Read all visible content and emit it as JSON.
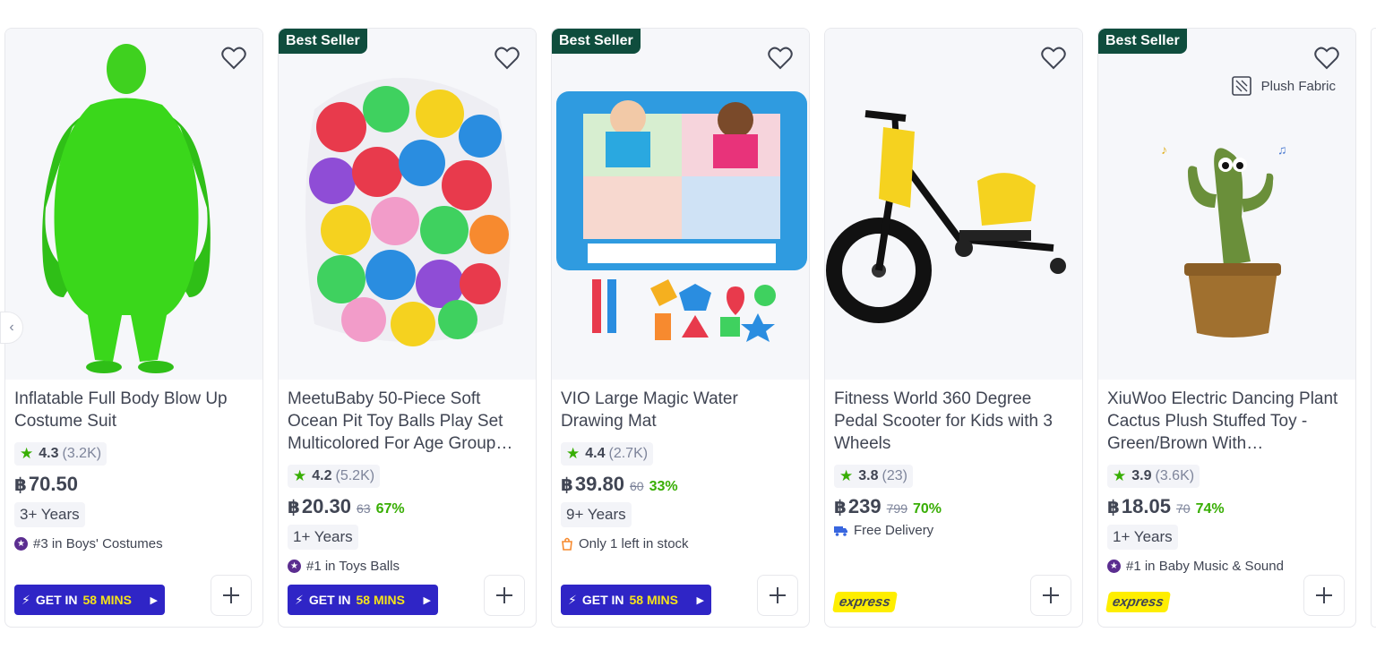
{
  "products": [
    {
      "badge": "",
      "title": "Inflatable Full Body Blow Up Costume Suit",
      "rating": "4.3",
      "rating_count": "3.2K",
      "currency": "฿",
      "price": "70.50",
      "old_price": "",
      "discount": "",
      "age": "3+ Years",
      "rank": "#3 in Boys' Costumes",
      "delivery_type": "fast",
      "fast_prefix": "GET IN",
      "fast_mins": "58 MINS"
    },
    {
      "badge": "Best Seller",
      "title": "MeetuBaby 50-Piece Soft Ocean Pit Toy Balls Play Set Multicolored For Age Group…",
      "rating": "4.2",
      "rating_count": "5.2K",
      "currency": "฿",
      "price": "20.30",
      "old_price": "63",
      "discount": "67%",
      "age": "1+ Years",
      "rank": "#1 in Toys Balls",
      "delivery_type": "fast",
      "fast_prefix": "GET IN",
      "fast_mins": "58 MINS"
    },
    {
      "badge": "Best Seller",
      "title": "VIO Large Magic Water Drawing Mat",
      "rating": "4.4",
      "rating_count": "2.7K",
      "currency": "฿",
      "price": "39.80",
      "old_price": "60",
      "discount": "33%",
      "age": "9+ Years",
      "stock": "Only 1 left in stock",
      "delivery_type": "fast",
      "fast_prefix": "GET IN",
      "fast_mins": "58 MINS"
    },
    {
      "badge": "",
      "title": "Fitness World 360 Degree Pedal Scooter for Kids with 3 Wheels",
      "rating": "3.8",
      "rating_count": "23",
      "currency": "฿",
      "price": "239",
      "old_price": "799",
      "discount": "70%",
      "free_delivery": "Free Delivery",
      "delivery_type": "express",
      "express_label": "express"
    },
    {
      "badge": "Best Seller",
      "tag": "Plush Fabric",
      "title": "XiuWoo Electric Dancing Plant Cactus Plush Stuffed Toy -Green/Brown With…",
      "rating": "3.9",
      "rating_count": "3.6K",
      "currency": "฿",
      "price": "18.05",
      "old_price": "70",
      "discount": "74%",
      "age": "1+ Years",
      "rank": "#1 in Baby Music & Sound",
      "delivery_type": "express",
      "express_label": "express"
    }
  ],
  "icons": {
    "wishlist": "heart-icon",
    "add": "plus-icon",
    "carousel_prev": "chevron-left-icon"
  },
  "colors": {
    "best_seller_bg": "#0f4d3d",
    "star": "#38ae04",
    "discount": "#38ae04",
    "fast_bg": "#2f25c6",
    "fast_mins": "#f5e31a",
    "express_bg": "#feee00"
  }
}
